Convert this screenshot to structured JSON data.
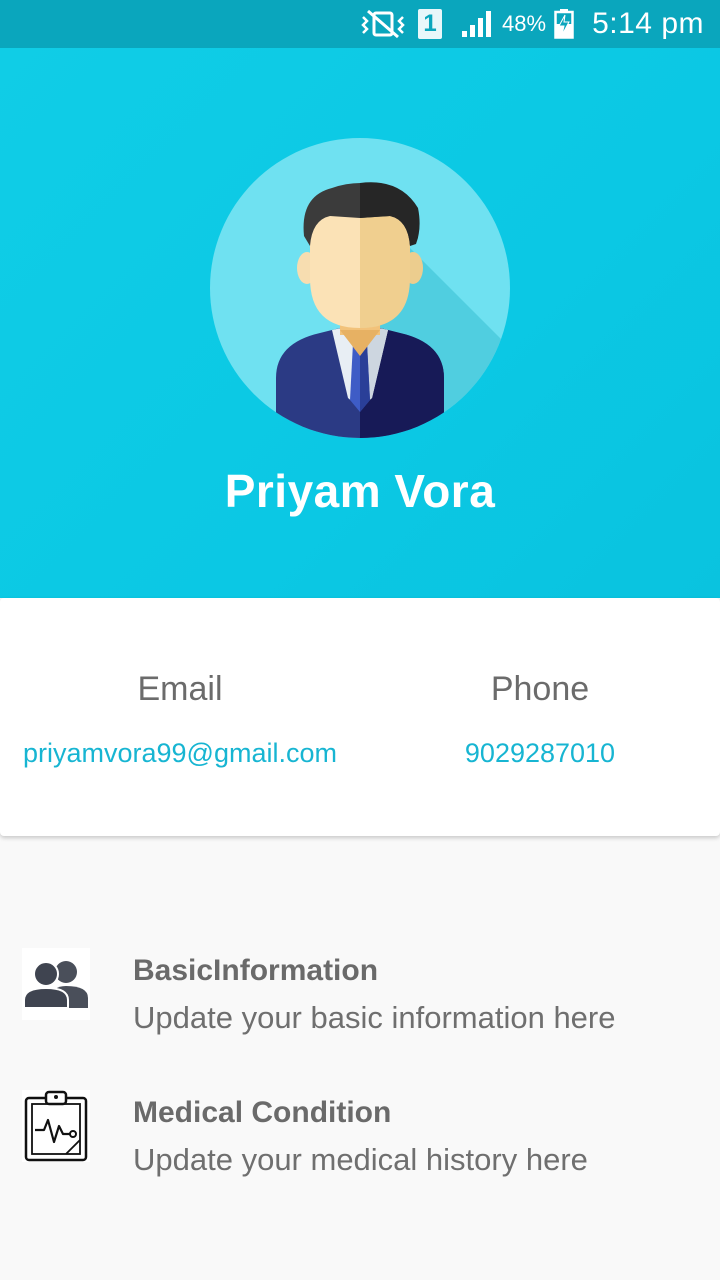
{
  "status_bar": {
    "battery_percent": "48%",
    "time": "5:14 pm",
    "sim_slot": "1",
    "icons": [
      "vibrate-off-icon",
      "sim-icon",
      "signal-icon",
      "battery-charging-icon"
    ]
  },
  "profile": {
    "name": "Priyam Vora",
    "avatar_icon": "user-avatar-icon"
  },
  "contact": {
    "email_label": "Email",
    "email_value": "priyamvora99@gmail.com",
    "phone_label": "Phone",
    "phone_value": "9029287010"
  },
  "menu": {
    "items": [
      {
        "title": "BasicInformation",
        "subtitle": "Update your basic information here",
        "icon": "users-icon"
      },
      {
        "title": "Medical Condition",
        "subtitle": "Update your medical history here",
        "icon": "medical-clipboard-icon"
      }
    ]
  },
  "colors": {
    "status_bar": "#0aa6bd",
    "header": "#0bc8e4",
    "accent_text": "#17b5d2",
    "label_text": "#6b6b6b",
    "background": "#f9f9f9"
  }
}
